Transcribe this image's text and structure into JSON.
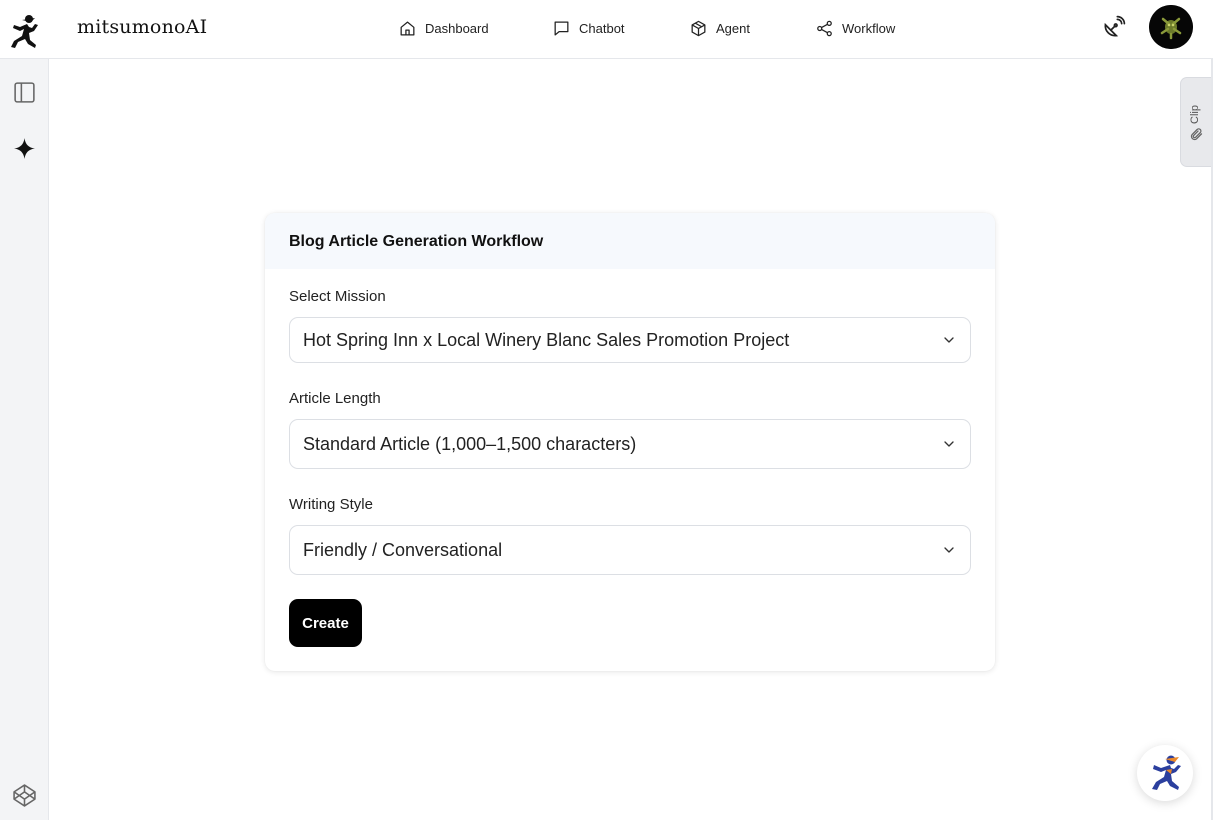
{
  "brand": {
    "name": "mitsumonoAI"
  },
  "nav": {
    "dashboard": "Dashboard",
    "chatbot": "Chatbot",
    "agent": "Agent",
    "workflow": "Workflow"
  },
  "clip": {
    "label": "Clip"
  },
  "card": {
    "title": "Blog Article Generation Workflow",
    "mission_label": "Select Mission",
    "mission_value": "Hot Spring Inn x Local Winery Blanc Sales Promotion Project",
    "length_label": "Article Length",
    "length_value": "Standard Article (1,000–1,500 characters)",
    "style_label": "Writing Style",
    "style_value": "Friendly / Conversational",
    "create_label": "Create"
  },
  "icons": {
    "logo": "running-ninja-logo",
    "dashboard": "home-icon",
    "chatbot": "chat-bubble-icon",
    "agent": "cube-icon",
    "workflow": "share-nodes-icon",
    "satellite": "satellite-dish-icon",
    "sidebar_toggle": "panel-left-icon",
    "sparkle": "sparkle-icon",
    "codepen": "codepen-icon",
    "paperclip": "paperclip-icon",
    "chevron": "chevron-down-icon"
  },
  "colors": {
    "primary_button": "#000000",
    "card_header_bg": "#f6f9fd",
    "sidebar_bg": "#f3f4f6",
    "fab_accent": "#2b3f9e"
  }
}
